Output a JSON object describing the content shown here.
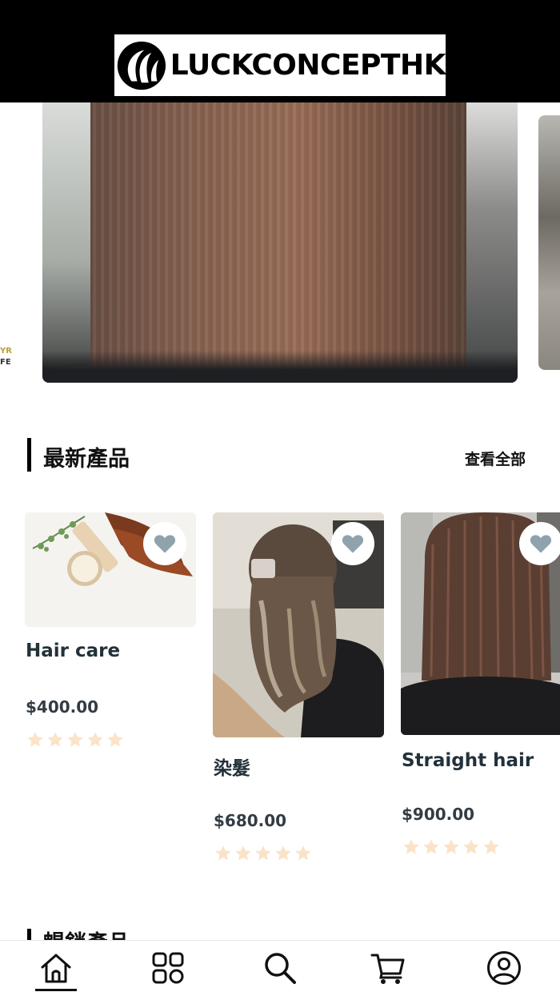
{
  "brand": {
    "name": "LUCKCONCEPTHK"
  },
  "banner": {
    "left_partial_text_top": "YR",
    "left_partial_text_bottom": "FE"
  },
  "section_new": {
    "title": "最新產品",
    "view_all": "查看全部"
  },
  "products": [
    {
      "title": "Hair care",
      "price": "$400.00",
      "rating": 0,
      "max_rating": 5
    },
    {
      "title": "染髮",
      "price": "$680.00",
      "rating": 0,
      "max_rating": 5
    },
    {
      "title": "Straight hair",
      "price": "$900.00",
      "rating": 0,
      "max_rating": 5
    }
  ],
  "section_next": {
    "title": "暢銷產品"
  },
  "bottom_nav": [
    {
      "icon": "home-icon",
      "active": true
    },
    {
      "icon": "categories-icon",
      "active": false
    },
    {
      "icon": "search-icon",
      "active": false
    },
    {
      "icon": "cart-icon",
      "active": false
    },
    {
      "icon": "user-icon",
      "active": false
    }
  ],
  "colors": {
    "header_bg": "#000000",
    "star": "#fbe3c8",
    "fav_heart": "#8fa3ad"
  }
}
